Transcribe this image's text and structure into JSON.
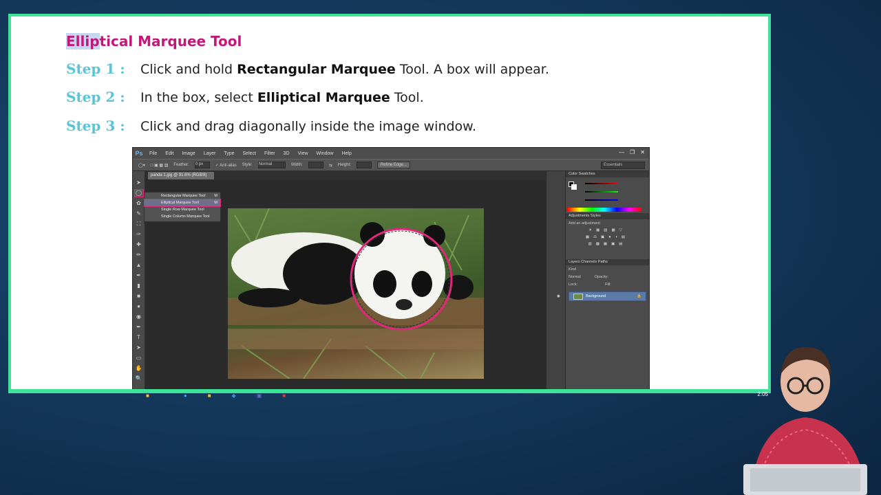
{
  "slide": {
    "title_highlighted": "Ellip",
    "title_rest": "tical Marquee Tool",
    "steps": [
      {
        "label": "Step 1 :",
        "text_before": "Click and hold ",
        "bold": "Rectangular Marquee",
        "text_after": " Tool. A box will appear."
      },
      {
        "label": "Step 2 :",
        "text_before": "In the box, select ",
        "bold": "Elliptical Marquee",
        "text_after": " Tool."
      },
      {
        "label": "Step 3 :",
        "text_before": "Click and drag diagonally inside the image window.",
        "bold": "",
        "text_after": ""
      }
    ]
  },
  "photoshop": {
    "logo": "Ps",
    "menu": [
      "File",
      "Edit",
      "Image",
      "Layer",
      "Type",
      "Select",
      "Filter",
      "3D",
      "View",
      "Window",
      "Help"
    ],
    "options": {
      "feather_label": "Feather:",
      "feather_value": "0 px",
      "antialias_label": "Anti-alias",
      "style_label": "Style:",
      "style_value": "Normal",
      "width_label": "Width:",
      "height_label": "Height:",
      "refine_button": "Refine Edge...",
      "workspace": "Essentials"
    },
    "doc_tab": "panda 1.jpg @ 91.6% (RGB/8)",
    "flyout": [
      {
        "label": "Rectangular Marquee Tool",
        "key": "M",
        "selected": false
      },
      {
        "label": "Elliptical Marquee Tool",
        "key": "M",
        "selected": true
      },
      {
        "label": "Single Row Marquee Tool",
        "key": "",
        "selected": false
      },
      {
        "label": "Single Column Marquee Tool",
        "key": "",
        "selected": false
      }
    ],
    "panels": {
      "color_tabs": "Color   Swatches",
      "adjust_tabs": "Adjustments   Styles",
      "add_adjustment": "Add an adjustment",
      "layer_tabs": "Layers   Channels   Paths",
      "kind_label": "Kind",
      "blend_mode": "Normal",
      "opacity_label": "Opacity:",
      "lock_label": "Lock:",
      "fill_label": "Fill:",
      "layer_name": "Background"
    }
  },
  "taskbar": {
    "clock": "2:05"
  },
  "colors": {
    "accent": "#c2187a",
    "step": "#5bc4d4",
    "frame": "#3ee39a"
  }
}
